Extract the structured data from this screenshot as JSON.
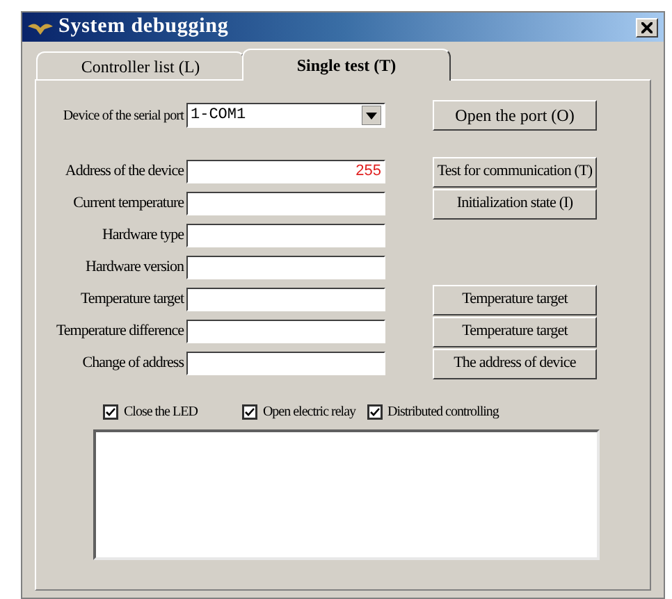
{
  "window": {
    "title": "System debugging"
  },
  "tabs": [
    {
      "label": "Controller list (L)",
      "selected": false
    },
    {
      "label": "Single test (T)",
      "selected": true
    }
  ],
  "serial_port": {
    "label": "Device of the serial port",
    "value": "1-COM1",
    "button": "Open the port (O)"
  },
  "fields": [
    {
      "label": "Address of the device",
      "value": "255",
      "button": "Test for communication (T)"
    },
    {
      "label": "Current temperature",
      "button": "Initialization state (I)"
    },
    {
      "label": "Hardware type"
    },
    {
      "label": "Hardware version"
    },
    {
      "label": "Temperature target",
      "button": "Temperature target"
    },
    {
      "label": "Temperature difference",
      "button": "Temperature target"
    },
    {
      "label": "Change of address",
      "button": "The address of device"
    }
  ],
  "checkboxes": [
    {
      "label": "Close the LED",
      "checked": true
    },
    {
      "label": "Open electric relay",
      "checked": true
    },
    {
      "label": "Distributed controlling",
      "checked": true
    }
  ]
}
